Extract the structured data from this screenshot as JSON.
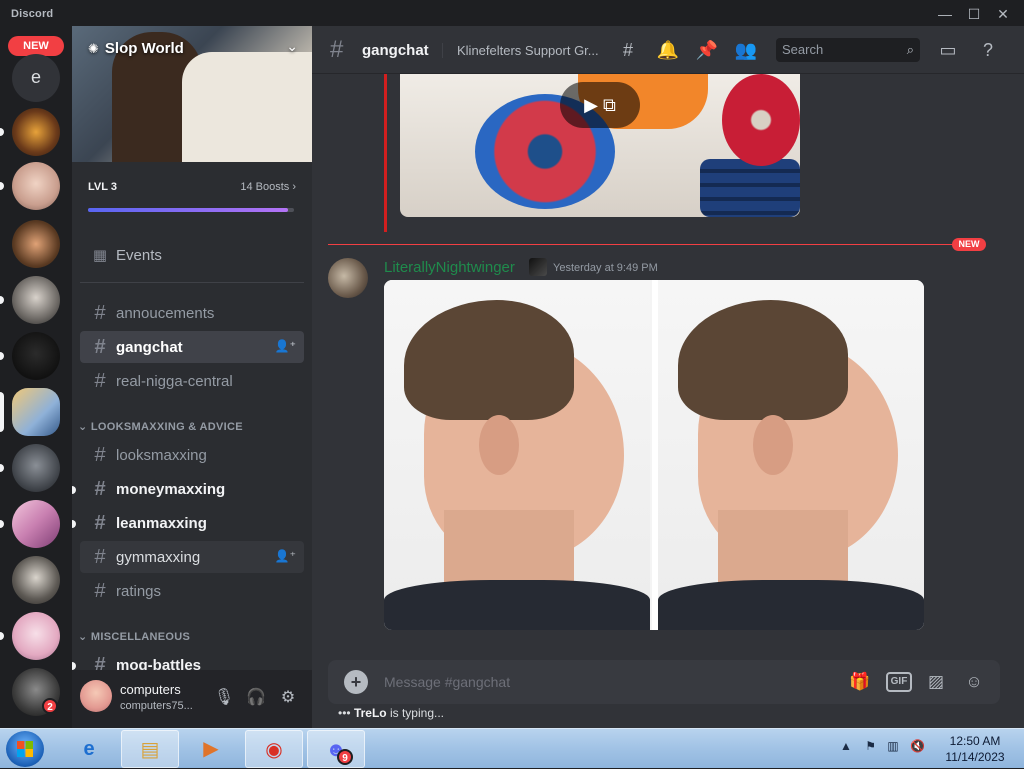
{
  "window": {
    "title": "Discord",
    "minimize": "—",
    "maximize": "☐",
    "close": "✕"
  },
  "rail": {
    "new_label": "NEW",
    "home_letter": "e",
    "unread_badge": "2"
  },
  "server": {
    "name": "Slop World",
    "level": "LVL 3",
    "boosts": "14 Boosts",
    "boost_progress": 0.97
  },
  "channels": {
    "events_label": "Events",
    "top": [
      {
        "name": "annoucements"
      },
      {
        "name": "gangchat"
      },
      {
        "name": "real-nigga-central"
      }
    ],
    "categories": [
      {
        "name": "LOOKSMAXXING & ADVICE",
        "channels": [
          {
            "name": "looksmaxxing"
          },
          {
            "name": "moneymaxxing"
          },
          {
            "name": "leanmaxxing"
          },
          {
            "name": "gymmaxxing"
          },
          {
            "name": "ratings"
          }
        ]
      },
      {
        "name": "MISCELLANEOUS",
        "channels": [
          {
            "name": "mog-battles"
          }
        ]
      }
    ]
  },
  "user": {
    "name": "computers",
    "tag": "computers75..."
  },
  "header": {
    "channel": "gangchat",
    "topic": "Klinefelters Support Gr...",
    "search_placeholder": "Search"
  },
  "message": {
    "new_tag": "NEW",
    "author": "LiterallyNightwinger",
    "time": "Yesterday at 9:49 PM"
  },
  "composer": {
    "placeholder": "Message #gangchat",
    "gif_label": "GIF",
    "typing_user": "TreLo",
    "typing_suffix": "is typing..."
  },
  "taskbar": {
    "time": "12:50 AM",
    "date": "11/14/2023",
    "discord_badge": "9"
  },
  "colors": {
    "accent": "#5865f2",
    "danger": "#f23f43",
    "author": "#1f8b4c"
  }
}
